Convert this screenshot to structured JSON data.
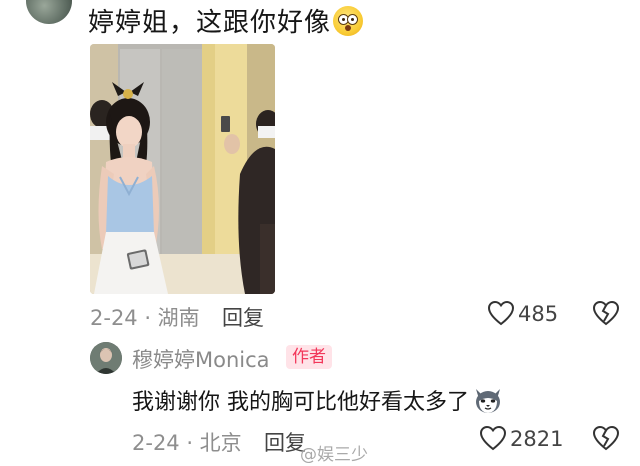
{
  "comment": {
    "text": "婷婷姐，这跟你好像",
    "emoji": "flushed-face",
    "date_location": "2-24 · 湖南",
    "reply_label": "回复",
    "likes": "485"
  },
  "reply": {
    "author_name": "穆婷婷Monica",
    "badge": "作者",
    "text": "我谢谢你 我的胸可比他好看太多了",
    "emoji": "husky-dog-face",
    "date_location": "2-24 · 北京",
    "reply_label": "回复",
    "likes": "2821"
  },
  "watermark": "@娱三少",
  "colors": {
    "badge_text": "#f2375a",
    "badge_bg": "#ffe3e8",
    "meta_gray": "#8e8e8e"
  }
}
